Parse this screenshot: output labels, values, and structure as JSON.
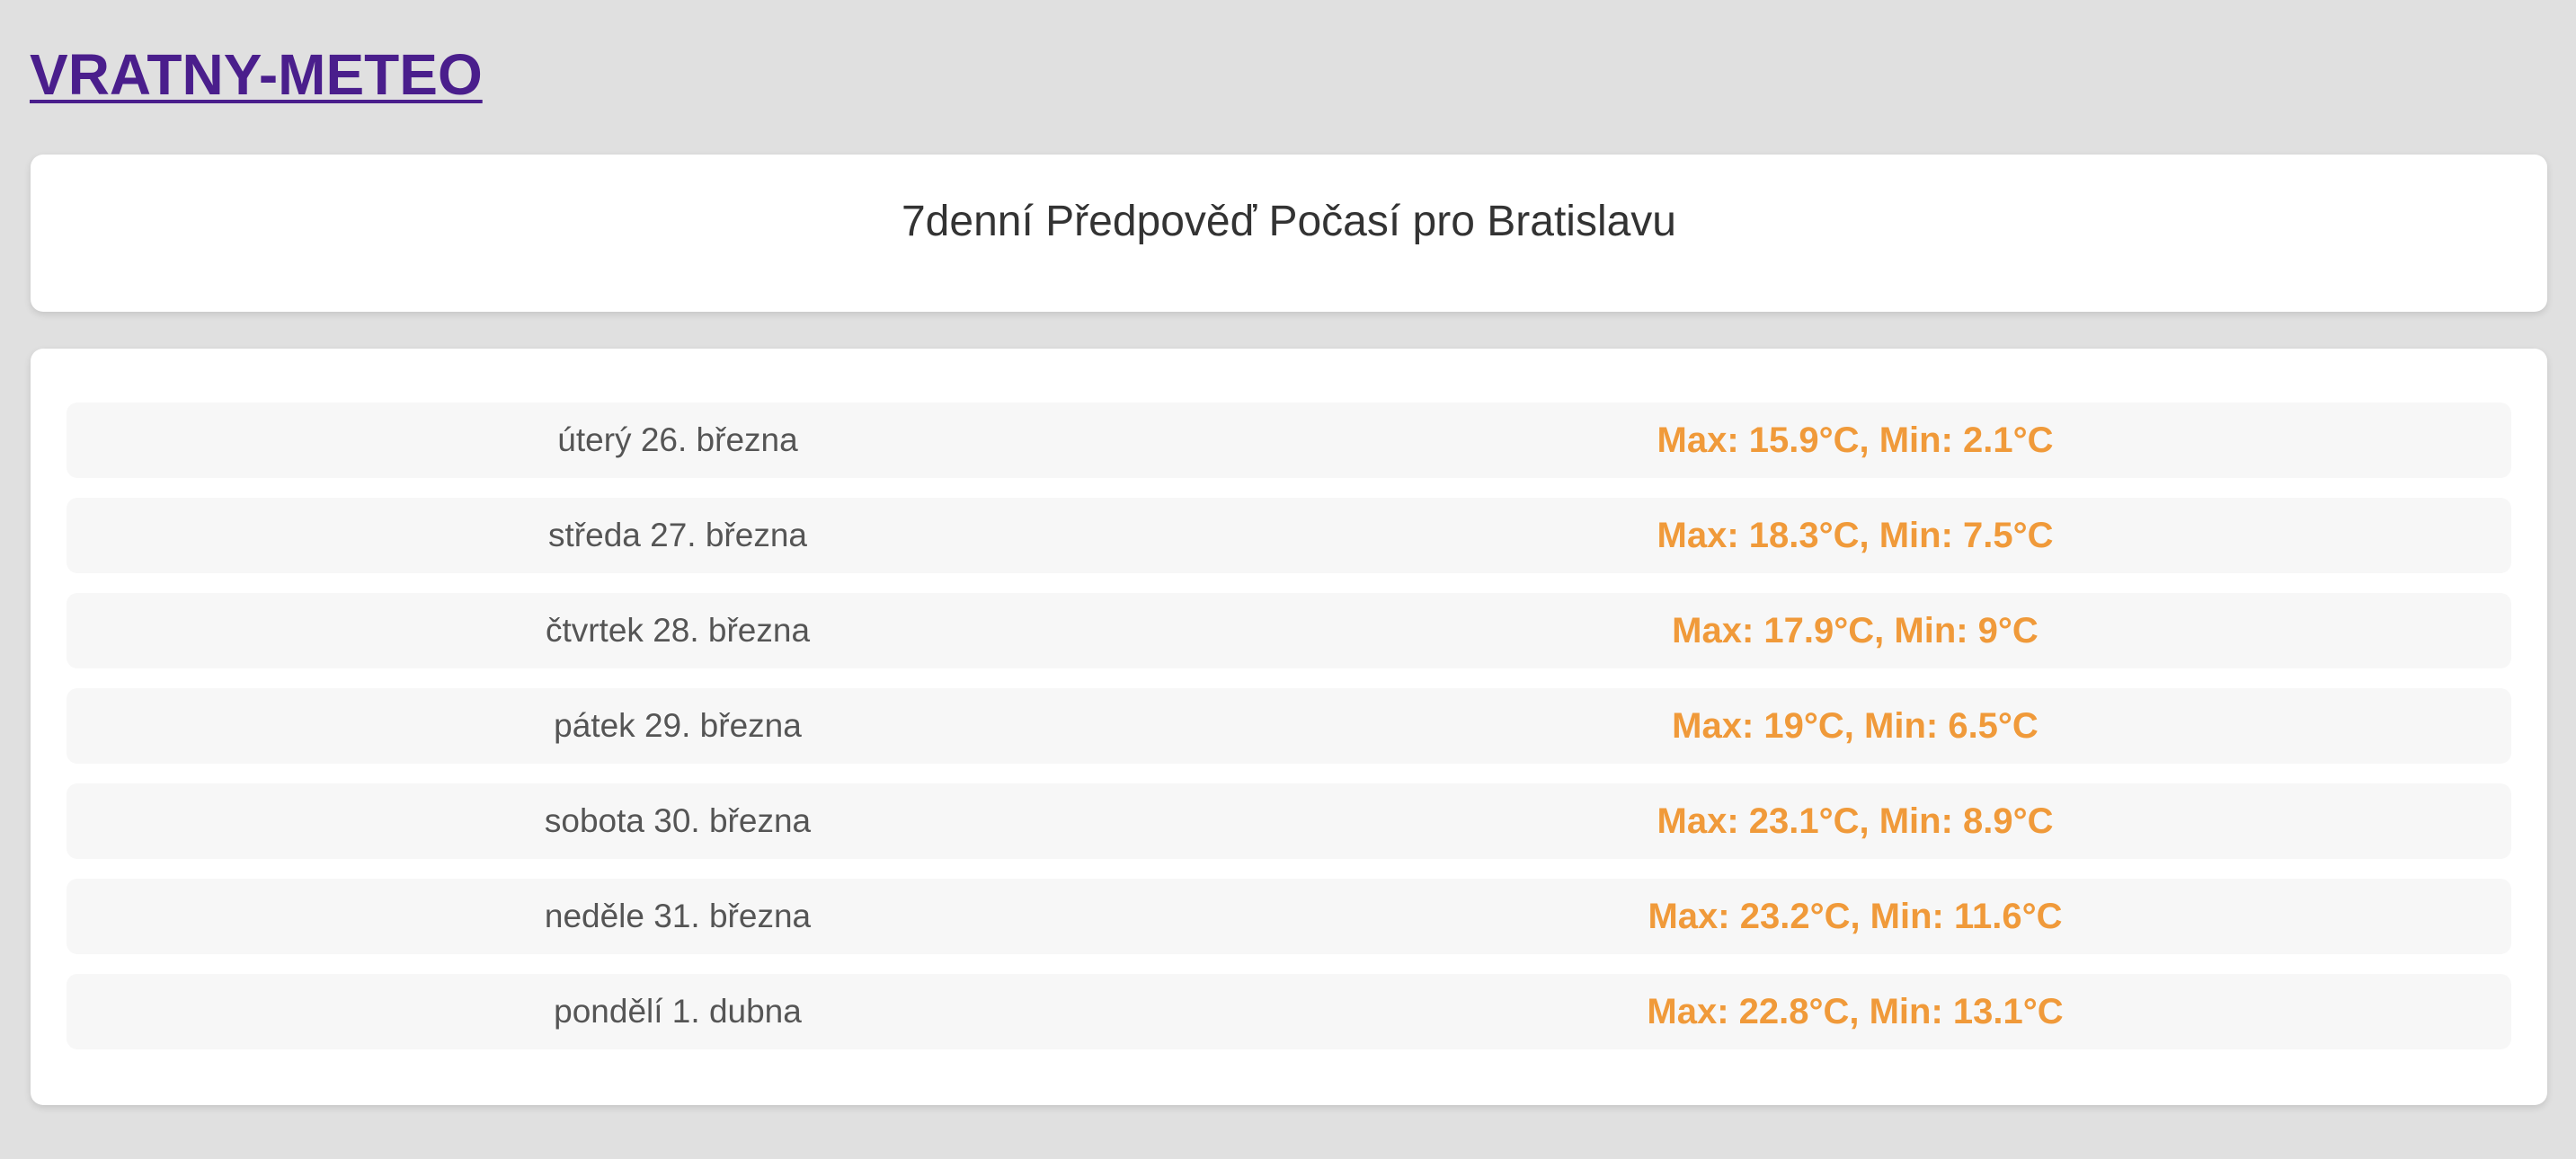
{
  "header": {
    "brand": "VRATNY-METEO"
  },
  "title": "7denní Předpověď Počasí pro Bratislavu",
  "colors": {
    "background": "#e0e0e0",
    "brand": "#4a1e8c",
    "temperature": "#f09a3a",
    "day_text": "#555555"
  },
  "forecast": [
    {
      "day": "úterý 26. března",
      "temps": "Max: 15.9°C, Min: 2.1°C"
    },
    {
      "day": "středa 27. března",
      "temps": "Max: 18.3°C, Min: 7.5°C"
    },
    {
      "day": "čtvrtek 28. března",
      "temps": "Max: 17.9°C, Min: 9°C"
    },
    {
      "day": "pátek 29. března",
      "temps": "Max: 19°C, Min: 6.5°C"
    },
    {
      "day": "sobota 30. března",
      "temps": "Max: 23.1°C, Min: 8.9°C"
    },
    {
      "day": "neděle 31. března",
      "temps": "Max: 23.2°C, Min: 11.6°C"
    },
    {
      "day": "pondělí 1. dubna",
      "temps": "Max: 22.8°C, Min: 13.1°C"
    }
  ]
}
